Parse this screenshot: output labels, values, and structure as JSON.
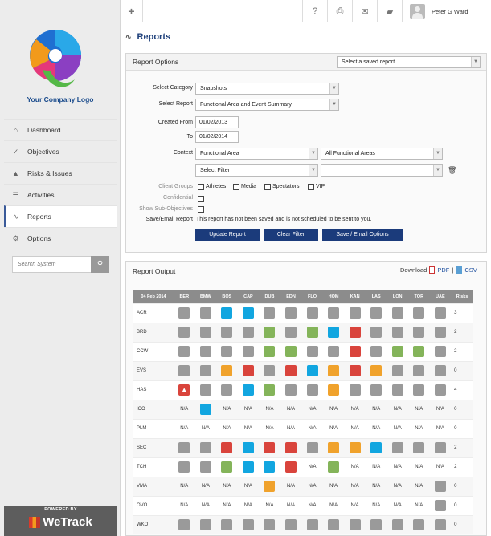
{
  "brand": {
    "logo_text": "Your Company Logo",
    "powered_by": "POWERED BY",
    "wetrack": "WeTrack"
  },
  "topbar": {
    "user_name": "Peter G Ward"
  },
  "sidebar": {
    "items": [
      {
        "label": "Dashboard",
        "icon": "home-icon"
      },
      {
        "label": "Objectives",
        "icon": "check-icon"
      },
      {
        "label": "Risks & Issues",
        "icon": "warning-icon"
      },
      {
        "label": "Activities",
        "icon": "list-icon"
      },
      {
        "label": "Reports",
        "icon": "chart-icon",
        "active": true
      },
      {
        "label": "Options",
        "icon": "gear-icon"
      }
    ],
    "search_placeholder": "Search System"
  },
  "page": {
    "title": "Reports"
  },
  "options": {
    "heading": "Report Options",
    "saved_report_placeholder": "Select a saved report...",
    "labels": {
      "category": "Select Category",
      "report": "Select Report",
      "created_from": "Created From",
      "to": "To",
      "context": "Context",
      "client_groups": "Client Groups",
      "confidential": "Confidential",
      "show_sub": "Show Sub-Objectives",
      "save_email": "Save/Email Report"
    },
    "category_value": "Snapshots",
    "report_value": "Functional Area and Event Summary",
    "created_from_value": "01/02/2013",
    "to_value": "01/02/2014",
    "context_value": "Functional Area",
    "context_value2": "All Functional Areas",
    "filter_placeholder": "Select Filter",
    "client_group_options": [
      "Athletes",
      "Media",
      "Spectators",
      "VIP"
    ],
    "save_email_note": "This report has not been saved and is not scheduled to be sent to you.",
    "buttons": {
      "update": "Update Report",
      "clear": "Clear Filter",
      "save": "Save / Email Options"
    }
  },
  "output": {
    "heading": "Report Output",
    "download_label": "Download",
    "pdf": "PDF",
    "sep": "|",
    "csv": "CSV",
    "date_col": "04 Feb 2014",
    "columns": [
      "BER",
      "BMW",
      "BOS",
      "CAP",
      "DUB",
      "EDN",
      "FLO",
      "HOM",
      "KAN",
      "LAS",
      "LON",
      "TOR",
      "UAE"
    ],
    "risks_col": "Risks",
    "na": "N/A",
    "status_colors": {
      "gray": "#9a9a9a",
      "blue": "#12a6e0",
      "orange": "#f0a22c",
      "red": "#d9443c",
      "green": "#84b45a"
    },
    "rows": [
      {
        "label": "ACR",
        "cells": [
          "gray",
          "gray",
          "blue",
          "blue",
          "gray",
          "gray",
          "gray",
          "gray",
          "gray",
          "gray",
          "gray",
          "gray",
          "gray"
        ],
        "risks": "3"
      },
      {
        "label": "BRD",
        "cells": [
          "gray",
          "gray",
          "gray",
          "gray",
          "green",
          "gray",
          "green",
          "blue",
          "red",
          "gray",
          "gray",
          "gray",
          "gray"
        ],
        "risks": "2"
      },
      {
        "label": "CCW",
        "cells": [
          "gray",
          "gray",
          "gray",
          "gray",
          "green",
          "green",
          "gray",
          "gray",
          "red",
          "gray",
          "green",
          "green",
          "gray"
        ],
        "risks": "2"
      },
      {
        "label": "EVS",
        "cells": [
          "gray",
          "gray",
          "orange",
          "red",
          "gray",
          "red",
          "blue",
          "orange",
          "red",
          "orange",
          "gray",
          "gray",
          "gray"
        ],
        "risks": "0"
      },
      {
        "label": "HAS",
        "cells": [
          "alert",
          "gray",
          "gray",
          "blue",
          "green",
          "gray",
          "gray",
          "orange",
          "gray",
          "gray",
          "gray",
          "gray",
          "gray"
        ],
        "risks": "4"
      },
      {
        "label": "ICO",
        "cells": [
          "N/A",
          "blue",
          "N/A",
          "N/A",
          "N/A",
          "N/A",
          "N/A",
          "N/A",
          "N/A",
          "N/A",
          "N/A",
          "N/A",
          "N/A"
        ],
        "risks": "0"
      },
      {
        "label": "PLM",
        "cells": [
          "N/A",
          "N/A",
          "N/A",
          "N/A",
          "N/A",
          "N/A",
          "N/A",
          "N/A",
          "N/A",
          "N/A",
          "N/A",
          "N/A",
          "N/A"
        ],
        "risks": "0"
      },
      {
        "label": "SEC",
        "cells": [
          "gray",
          "gray",
          "red",
          "blue",
          "red",
          "red",
          "gray",
          "orange",
          "orange",
          "blue",
          "gray",
          "gray",
          "gray"
        ],
        "risks": "2"
      },
      {
        "label": "TCH",
        "cells": [
          "gray",
          "gray",
          "green",
          "blue",
          "blue",
          "red",
          "N/A",
          "green",
          "N/A",
          "N/A",
          "N/A",
          "N/A",
          "N/A"
        ],
        "risks": "2"
      },
      {
        "label": "VMA",
        "cells": [
          "N/A",
          "N/A",
          "N/A",
          "N/A",
          "orange",
          "N/A",
          "N/A",
          "N/A",
          "N/A",
          "N/A",
          "N/A",
          "N/A",
          "gray"
        ],
        "risks": "0"
      },
      {
        "label": "OVO",
        "cells": [
          "N/A",
          "N/A",
          "N/A",
          "N/A",
          "N/A",
          "N/A",
          "N/A",
          "N/A",
          "N/A",
          "N/A",
          "N/A",
          "N/A",
          "gray"
        ],
        "risks": "0"
      },
      {
        "label": "WKO",
        "cells": [
          "gray",
          "gray",
          "gray",
          "gray",
          "gray",
          "gray",
          "gray",
          "gray",
          "gray",
          "gray",
          "gray",
          "gray",
          "gray"
        ],
        "risks": "0"
      }
    ]
  }
}
